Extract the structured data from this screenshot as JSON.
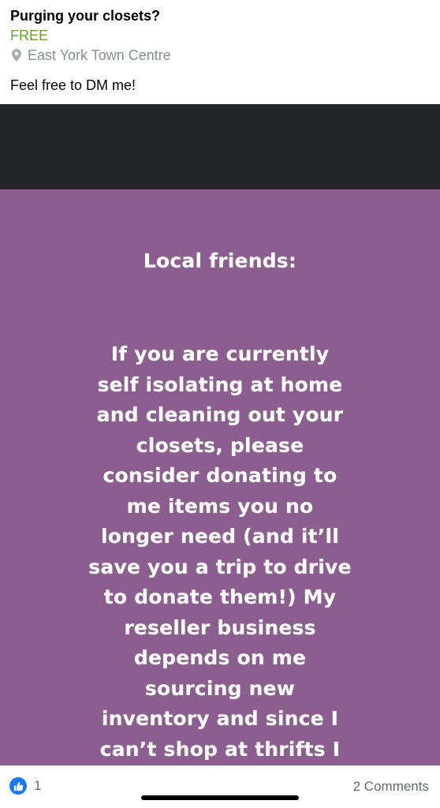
{
  "listing": {
    "title": "Purging your closets?",
    "price": "FREE",
    "location": "East York Town Centre",
    "location_icon": "map-pin-icon",
    "description": "Feel free to DM me!"
  },
  "photo": {
    "heading": "Local friends:",
    "body_lines": [
      "If you are currently",
      "self isolating at home",
      "and cleaning out your",
      "closets, please",
      "consider donating to",
      "me items you no",
      "longer need (and it’ll",
      "save you a trip to drive",
      "to donate them!) My",
      "reseller business",
      "depends on me",
      "sourcing new",
      "inventory and since I",
      "can’t shop at thrifts I"
    ],
    "colors": {
      "top_bar": "#242527",
      "background": "#8c5e90",
      "text": "#ffffff"
    }
  },
  "footer": {
    "reaction_icon": "like-icon",
    "reaction_count": "1",
    "comments": "2 Comments"
  },
  "colors": {
    "price": "#6aa12f",
    "meta": "#8a8d91",
    "like": "#1877f2"
  }
}
